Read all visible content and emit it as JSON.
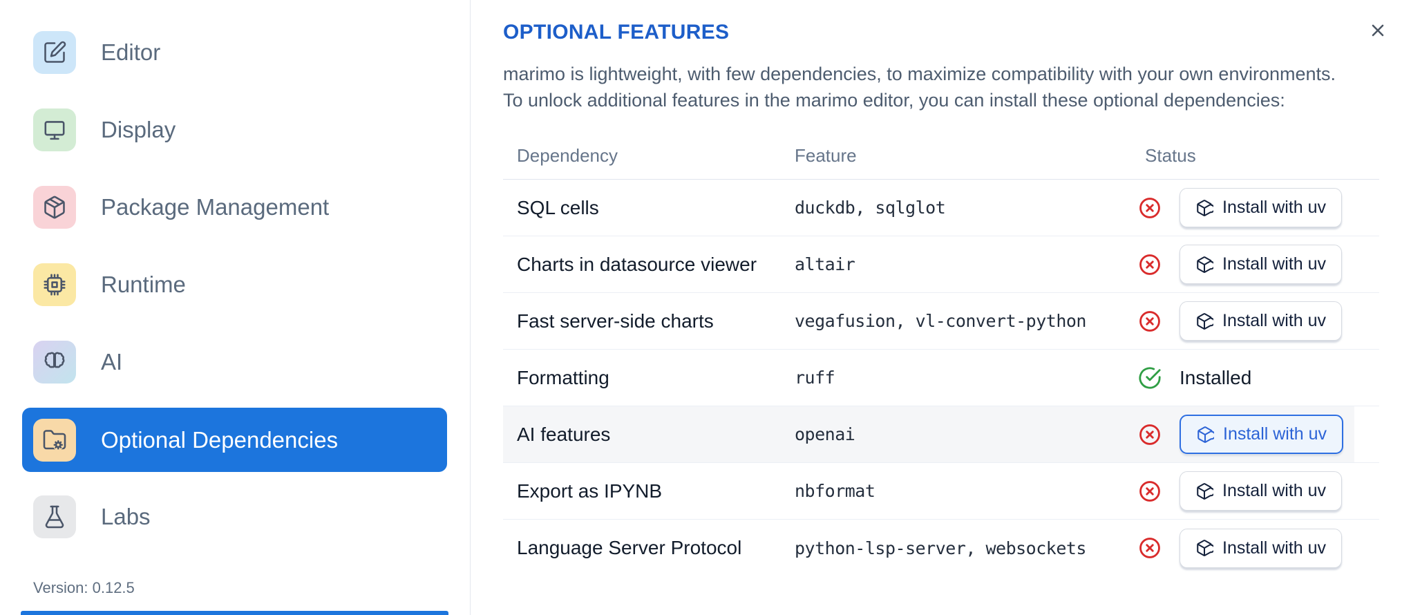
{
  "colors": {
    "accent_blue": "#1c75dd",
    "title_blue": "#1d5ec9",
    "button_blue": "#2c63d6",
    "status_red": "#d92b2b",
    "status_green": "#2f9e44"
  },
  "sidebar": {
    "items": [
      {
        "label": "Editor",
        "icon": "edit-icon",
        "icon_bg": "#cde6f9"
      },
      {
        "label": "Display",
        "icon": "monitor-icon",
        "icon_bg": "#d3ecd4"
      },
      {
        "label": "Package Management",
        "icon": "package-icon",
        "icon_bg": "#f9d3d7"
      },
      {
        "label": "Runtime",
        "icon": "cpu-icon",
        "icon_bg": "#fbe8a4"
      },
      {
        "label": "AI",
        "icon": "brain-icon",
        "icon_bg": "linear-gradient(135deg,#d9d2f0,#c2e4ee)"
      },
      {
        "label": "Optional Dependencies",
        "icon": "folder-cog-icon",
        "icon_bg": "#f8d9a8",
        "selected": true
      },
      {
        "label": "Labs",
        "icon": "flask-icon",
        "icon_bg": "#e7e8ea"
      }
    ],
    "version_label": "Version: 0.12.5"
  },
  "main": {
    "title": "OPTIONAL FEATURES",
    "description_line1": "marimo is lightweight, with few dependencies, to maximize compatibility with your own environments.",
    "description_line2": "To unlock additional features in the marimo editor, you can install these optional dependencies:",
    "table": {
      "columns": [
        "Dependency",
        "Feature",
        "Status"
      ],
      "installed_label": "Installed",
      "rows": [
        {
          "dependency": "SQL cells",
          "feature": "duckdb, sqlglot",
          "status": "missing",
          "button": "Install with uv"
        },
        {
          "dependency": "Charts in datasource viewer",
          "feature": "altair",
          "status": "missing",
          "button": "Install with uv"
        },
        {
          "dependency": "Fast server-side charts",
          "feature": "vegafusion, vl-convert-python",
          "status": "missing",
          "button": "Install with uv"
        },
        {
          "dependency": "Formatting",
          "feature": "ruff",
          "status": "installed"
        },
        {
          "dependency": "AI features",
          "feature": "openai",
          "status": "missing",
          "button": "Install with uv",
          "highlighted": true
        },
        {
          "dependency": "Export as IPYNB",
          "feature": "nbformat",
          "status": "missing",
          "button": "Install with uv"
        },
        {
          "dependency": "Language Server Protocol",
          "feature": "python-lsp-server, websockets",
          "status": "missing",
          "button": "Install with uv"
        }
      ]
    }
  }
}
